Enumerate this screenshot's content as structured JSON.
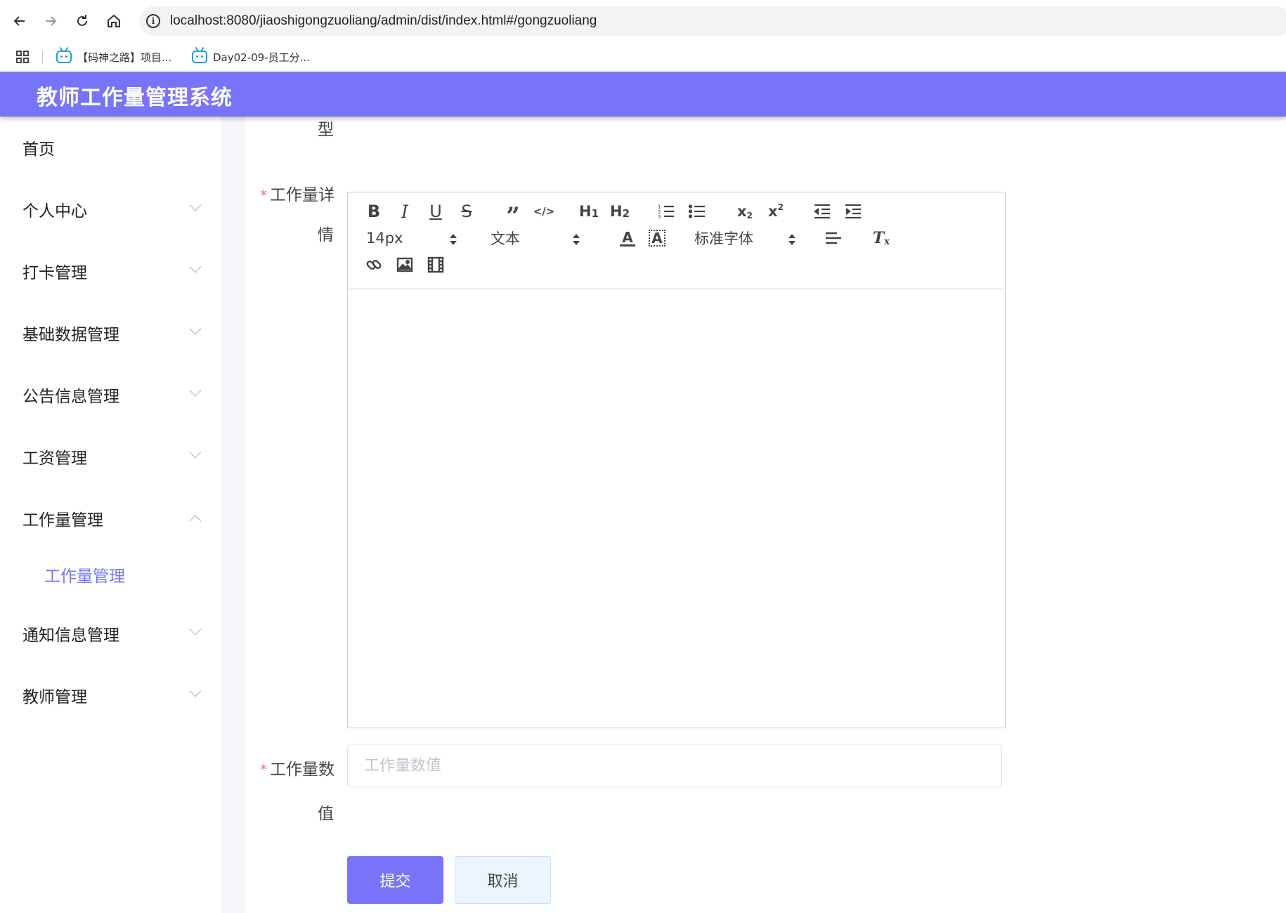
{
  "browser": {
    "url": "localhost:8080/jiaoshigongzuoliang/admin/dist/index.html#/gongzuoliang",
    "bookmarks": [
      {
        "label": "【码神之路】项目..."
      },
      {
        "label": "Day02-09-员工分..."
      }
    ]
  },
  "app": {
    "title": "教师工作量管理系统",
    "accent_color": "#7774fa"
  },
  "sidebar": {
    "items": [
      {
        "label": "首页",
        "expandable": false
      },
      {
        "label": "个人中心",
        "expandable": true,
        "expanded": false
      },
      {
        "label": "打卡管理",
        "expandable": true,
        "expanded": false
      },
      {
        "label": "基础数据管理",
        "expandable": true,
        "expanded": false
      },
      {
        "label": "公告信息管理",
        "expandable": true,
        "expanded": false
      },
      {
        "label": "工资管理",
        "expandable": true,
        "expanded": false
      },
      {
        "label": "工作量管理",
        "expandable": true,
        "expanded": true
      },
      {
        "label": "通知信息管理",
        "expandable": true,
        "expanded": false
      },
      {
        "label": "教师管理",
        "expandable": true,
        "expanded": false
      }
    ],
    "active_subitem": "工作量管理"
  },
  "form": {
    "prev_label_tail": "型",
    "detail_label_line1": "工作量详",
    "detail_label_line2": "情",
    "value_label_line1": "工作量数",
    "value_label_line2": "值",
    "value_placeholder": "工作量数值",
    "required_mark": "*",
    "submit_label": "提交",
    "cancel_label": "取消"
  },
  "editor": {
    "font_size": "14px",
    "header_select": "文本",
    "font_family": "标准字体",
    "icons": [
      "bold-icon",
      "italic-icon",
      "underline-icon",
      "strike-icon",
      "blockquote-icon",
      "code-block-icon",
      "header1-icon",
      "header2-icon",
      "ordered-list-icon",
      "bullet-list-icon",
      "subscript-icon",
      "superscript-icon",
      "outdent-icon",
      "indent-icon",
      "text-color-icon",
      "background-color-icon",
      "align-left-icon",
      "clean-format-icon",
      "link-icon",
      "image-icon",
      "video-icon"
    ]
  }
}
